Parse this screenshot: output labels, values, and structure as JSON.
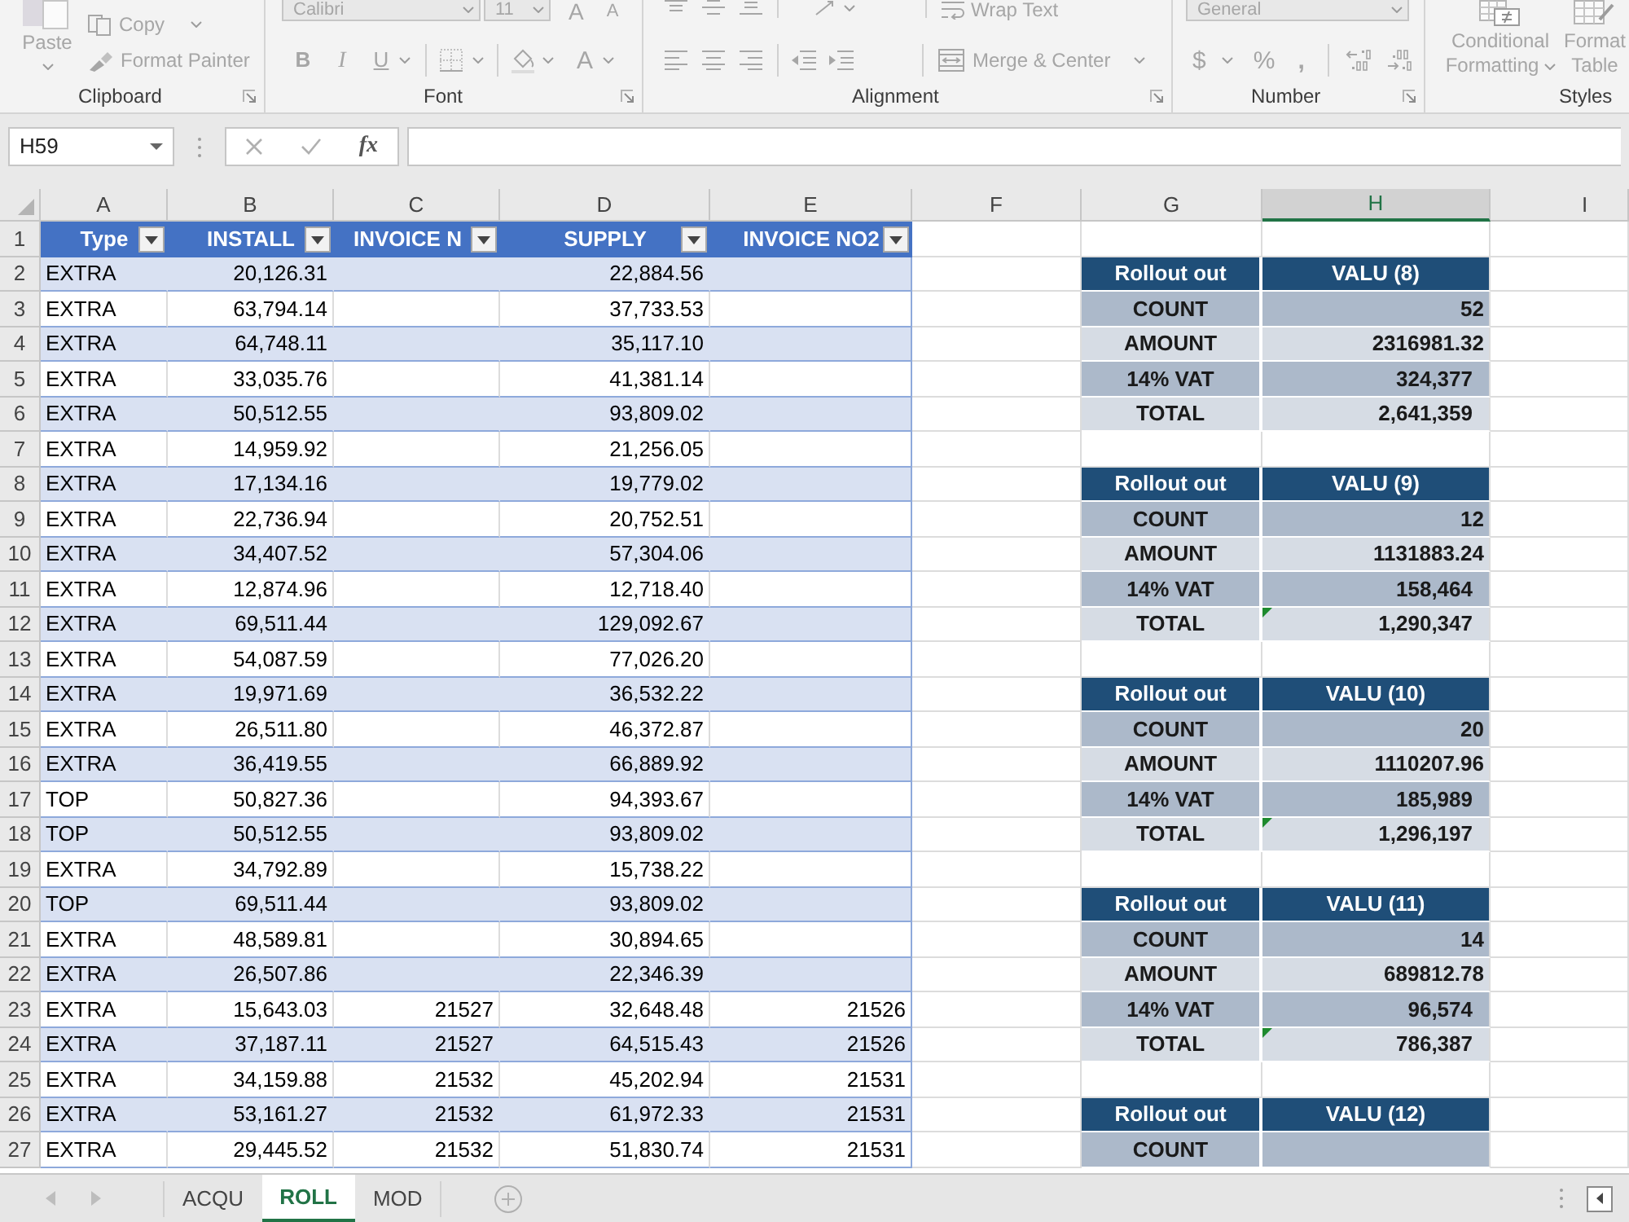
{
  "ribbon": {
    "clipboard": {
      "label": "Clipboard",
      "paste": "Paste",
      "copy": "Copy",
      "format_painter": "Format Painter"
    },
    "font": {
      "label": "Font",
      "font_name": "Calibri",
      "font_size": "11",
      "grow_font": "A",
      "shrink_font": "A",
      "bold": "B",
      "italic": "I",
      "underline": "U",
      "font_color": "A"
    },
    "alignment": {
      "label": "Alignment",
      "wrap_text": "Wrap Text",
      "merge_center": "Merge & Center"
    },
    "number": {
      "label": "Number",
      "number_format": "General",
      "currency": "$",
      "percent": "%",
      "comma": ","
    },
    "styles": {
      "label": "Styles",
      "conditional_formatting": "Conditional Formatting",
      "format_table": [
        "Format",
        "Table"
      ]
    }
  },
  "formula_bar": {
    "name_box": "H59",
    "insert_function": "fx"
  },
  "columns": [
    {
      "label": "A",
      "selected": false
    },
    {
      "label": "B",
      "selected": false
    },
    {
      "label": "C",
      "selected": false
    },
    {
      "label": "D",
      "selected": false
    },
    {
      "label": "E",
      "selected": false
    },
    {
      "label": "F",
      "selected": false
    },
    {
      "label": "G",
      "selected": false
    },
    {
      "label": "H",
      "selected": true
    },
    {
      "label": "I",
      "selected": false
    }
  ],
  "row_numbers": [
    "1",
    "2",
    "3",
    "4",
    "5",
    "6",
    "7",
    "8",
    "9",
    "10",
    "11",
    "12",
    "13",
    "14",
    "15",
    "16",
    "17",
    "18",
    "19",
    "20",
    "21",
    "22",
    "23",
    "24",
    "25",
    "26",
    "27"
  ],
  "table": {
    "headers": [
      "Type",
      "INSTALL",
      "INVOICE N",
      "SUPPLY",
      "INVOICE NO2"
    ],
    "rows": [
      {
        "type": "EXTRA",
        "install": "20,126.31",
        "supply": "22,884.56"
      },
      {
        "type": "EXTRA",
        "install": "63,794.14",
        "supply": "37,733.53"
      },
      {
        "type": "EXTRA",
        "install": "64,748.11",
        "supply": "35,117.10"
      },
      {
        "type": "EXTRA",
        "install": "33,035.76",
        "supply": "41,381.14"
      },
      {
        "type": "EXTRA",
        "install": "50,512.55",
        "supply": "93,809.02"
      },
      {
        "type": "EXTRA",
        "install": "14,959.92",
        "supply": "21,256.05"
      },
      {
        "type": "EXTRA",
        "install": "17,134.16",
        "supply": "19,779.02"
      },
      {
        "type": "EXTRA",
        "install": "22,736.94",
        "supply": "20,752.51"
      },
      {
        "type": "EXTRA",
        "install": "34,407.52",
        "supply": "57,304.06"
      },
      {
        "type": "EXTRA",
        "install": "12,874.96",
        "supply": "12,718.40"
      },
      {
        "type": "EXTRA",
        "install": "69,511.44",
        "supply": "129,092.67"
      },
      {
        "type": "EXTRA",
        "install": "54,087.59",
        "supply": "77,026.20"
      },
      {
        "type": "EXTRA",
        "install": "19,971.69",
        "supply": "36,532.22"
      },
      {
        "type": "EXTRA",
        "install": "26,511.80",
        "supply": "46,372.87"
      },
      {
        "type": "EXTRA",
        "install": "36,419.55",
        "supply": "66,889.92"
      },
      {
        "type": "TOP",
        "install": "50,827.36",
        "supply": "94,393.67"
      },
      {
        "type": "TOP",
        "install": "50,512.55",
        "supply": "93,809.02"
      },
      {
        "type": "EXTRA",
        "install": "34,792.89",
        "supply": "15,738.22"
      },
      {
        "type": "TOP",
        "install": "69,511.44",
        "supply": "93,809.02"
      },
      {
        "type": "EXTRA",
        "install": "48,589.81",
        "supply": "30,894.65"
      },
      {
        "type": "EXTRA",
        "install": "26,507.86",
        "supply": "22,346.39"
      },
      {
        "type": "EXTRA",
        "install": "15,643.03",
        "invoice_no": "21527",
        "supply": "32,648.48",
        "invoice_no2": "21526"
      },
      {
        "type": "EXTRA",
        "install": "37,187.11",
        "invoice_no": "21527",
        "supply": "64,515.43",
        "invoice_no2": "21526"
      },
      {
        "type": "EXTRA",
        "install": "34,159.88",
        "invoice_no": "21532",
        "supply": "45,202.94",
        "invoice_no2": "21531"
      },
      {
        "type": "EXTRA",
        "install": "53,161.27",
        "invoice_no": "21532",
        "supply": "61,972.33",
        "invoice_no2": "21531"
      },
      {
        "type": "EXTRA",
        "install": "29,445.52",
        "invoice_no": "21532",
        "supply": "51,830.74",
        "invoice_no2": "21531"
      }
    ]
  },
  "summaries": [
    {
      "title": "Rollout out",
      "value_header": "VALU (8)",
      "rows": [
        {
          "label": "COUNT",
          "value": "52",
          "flagged": false
        },
        {
          "label": "AMOUNT",
          "value": "2316981.32",
          "flagged": false
        },
        {
          "label": "14% VAT",
          "value": "324,377",
          "flagged": false
        },
        {
          "label": "TOTAL",
          "value": "2,641,359",
          "flagged": false
        }
      ]
    },
    {
      "title": "Rollout out",
      "value_header": "VALU (9)",
      "rows": [
        {
          "label": "COUNT",
          "value": "12",
          "flagged": false
        },
        {
          "label": "AMOUNT",
          "value": "1131883.24",
          "flagged": false
        },
        {
          "label": "14% VAT",
          "value": "158,464",
          "flagged": false
        },
        {
          "label": "TOTAL",
          "value": "1,290,347",
          "flagged": true
        }
      ]
    },
    {
      "title": "Rollout out",
      "value_header": "VALU (10)",
      "rows": [
        {
          "label": "COUNT",
          "value": "20",
          "flagged": false
        },
        {
          "label": "AMOUNT",
          "value": "1110207.96",
          "flagged": false
        },
        {
          "label": "14% VAT",
          "value": "185,989",
          "flagged": false
        },
        {
          "label": "TOTAL",
          "value": "1,296,197",
          "flagged": true
        }
      ]
    },
    {
      "title": "Rollout out",
      "value_header": "VALU (11)",
      "rows": [
        {
          "label": "COUNT",
          "value": "14",
          "flagged": false
        },
        {
          "label": "AMOUNT",
          "value": "689812.78",
          "flagged": false
        },
        {
          "label": "14% VAT",
          "value": "96,574",
          "flagged": false
        },
        {
          "label": "TOTAL",
          "value": "786,387",
          "flagged": true
        }
      ]
    },
    {
      "title": "Rollout out",
      "value_header": "VALU (12)",
      "rows": [
        {
          "label": "COUNT",
          "flagged": false
        }
      ]
    }
  ],
  "sheet_tabs": [
    {
      "label": "ACQU",
      "selected": false
    },
    {
      "label": "ROLL",
      "selected": true
    },
    {
      "label": "MOD",
      "selected": false
    }
  ]
}
